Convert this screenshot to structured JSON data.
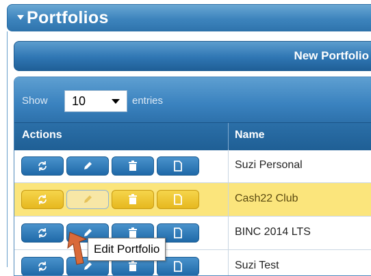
{
  "panel": {
    "title": "Portfolios"
  },
  "new_portfolio_label": "New Portfolio",
  "length_menu": {
    "show_label": "Show",
    "selected": "10",
    "entries_label": "entries"
  },
  "columns": {
    "actions": "Actions",
    "name": "Name"
  },
  "rows": [
    {
      "name": "Suzi Personal",
      "highlighted": false
    },
    {
      "name": "Cash22 Club",
      "highlighted": true
    },
    {
      "name": "BINC 2014 LTS",
      "highlighted": false
    },
    {
      "name": "Suzi Test",
      "highlighted": false
    }
  ],
  "row_action_icons": [
    "refresh-icon",
    "pencil-icon",
    "trash-icon",
    "document-icon"
  ],
  "tooltip": "Edit Portfolio",
  "colors": {
    "header_blue": "#3d84bd",
    "highlight_row": "#fbe57c",
    "button_blue": "#1f69a8",
    "button_yellow": "#e6b81f"
  }
}
